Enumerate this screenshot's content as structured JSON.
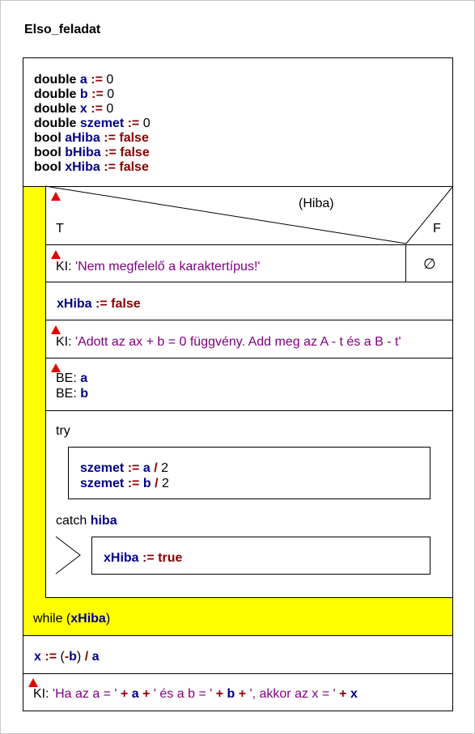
{
  "title": "Elso_feladat",
  "declarations": [
    {
      "type": "double",
      "name": "a",
      "op": ":=",
      "value": "0",
      "value_style": "num"
    },
    {
      "type": "double",
      "name": "b",
      "op": ":=",
      "value": "0",
      "value_style": "num"
    },
    {
      "type": "double",
      "name": "x",
      "op": ":=",
      "value": "0",
      "value_style": "num"
    },
    {
      "type": "double",
      "name": "szemet",
      "op": ":=",
      "value": "0",
      "value_style": "num"
    },
    {
      "type": "bool",
      "name": "aHiba",
      "op": ":=",
      "value": "false",
      "value_style": "lit"
    },
    {
      "type": "bool",
      "name": "bHiba",
      "op": ":=",
      "value": "false",
      "value_style": "lit"
    },
    {
      "type": "bool",
      "name": "xHiba",
      "op": ":=",
      "value": "false",
      "value_style": "lit"
    }
  ],
  "branch": {
    "condition": "(Hiba)",
    "true_label": "T",
    "false_label": "F",
    "true_stmt": {
      "kw": "KI:",
      "text": "'Nem megfelelő a karaktertípus!'"
    },
    "false_symbol": "∅"
  },
  "assign_xhiba": {
    "name": "xHiba",
    "op": ":=",
    "value": "false"
  },
  "prompt": {
    "kw": "KI:",
    "text": "'Adott az ax + b = 0 függvény. Add meg az A - t és a B - t'"
  },
  "inputs": [
    {
      "kw": "BE:",
      "name": "a"
    },
    {
      "kw": "BE:",
      "name": "b"
    }
  ],
  "try": {
    "label": "try",
    "stmts": [
      {
        "name": "szemet",
        "op": ":=",
        "lhs": "a",
        "div": "/",
        "rhs": "2"
      },
      {
        "name": "szemet",
        "op": ":=",
        "lhs": "b",
        "div": "/",
        "rhs": "2"
      }
    ]
  },
  "catch": {
    "label": "catch",
    "var": "hiba",
    "stmt": {
      "name": "xHiba",
      "op": ":=",
      "value": "true"
    }
  },
  "loop": {
    "kw": "while",
    "open": "(",
    "var": "xHiba",
    "close": ")"
  },
  "compute": {
    "name": "x",
    "op": ":=",
    "open": "(",
    "minus": "-",
    "b": "b",
    "close": ")",
    "div": "/",
    "a": "a"
  },
  "output": {
    "kw": "KI:",
    "s1": "'Ha az a = '",
    "plus": "+",
    "v1": "a",
    "s2": "' és a b = '",
    "v2": "b",
    "s3": "', akkor az x = '",
    "v3": "x"
  },
  "colors": {
    "loop_bg": "#ffff00",
    "keyword": "#000000",
    "variable": "#00008b",
    "operator": "#8b0000",
    "string": "#800080",
    "marker": "#e00000"
  }
}
